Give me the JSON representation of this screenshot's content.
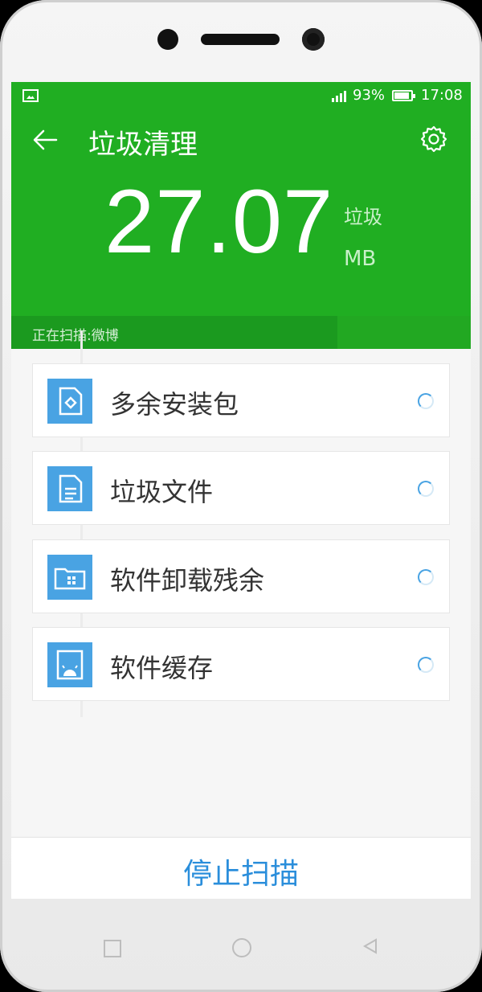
{
  "status": {
    "battery": "93%",
    "time": "17:08"
  },
  "header": {
    "title": "垃圾清理"
  },
  "summary": {
    "amount": "27.07",
    "unit_label": "垃圾",
    "unit": "MB"
  },
  "scan": {
    "label": "正在扫描:微博",
    "progress": 0.71
  },
  "items": [
    {
      "label": "多余安装包",
      "icon": "apk-file-icon",
      "status": "loading"
    },
    {
      "label": "垃圾文件",
      "icon": "document-icon",
      "status": "loading"
    },
    {
      "label": "软件卸载残余",
      "icon": "folder-icon",
      "status": "loading"
    },
    {
      "label": "软件缓存",
      "icon": "android-cache-icon",
      "status": "loading"
    }
  ],
  "footer": {
    "stop_label": "停止扫描"
  },
  "colors": {
    "accent_green": "#20ae22",
    "accent_blue": "#2a8edb",
    "icon_blue": "#49a3e3"
  }
}
